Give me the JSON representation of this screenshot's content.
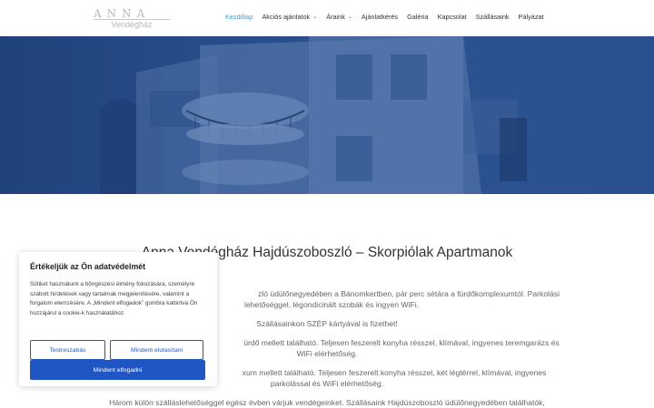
{
  "logo": {
    "top": "ANNA",
    "bottom": "Vendégház"
  },
  "nav": [
    {
      "label": "Kezdőlap",
      "active": true,
      "dropdown": false
    },
    {
      "label": "Akciós ajánlatok",
      "active": false,
      "dropdown": true
    },
    {
      "label": "Áraink",
      "active": false,
      "dropdown": true
    },
    {
      "label": "Ajánlatkérés",
      "active": false,
      "dropdown": false
    },
    {
      "label": "Galéria",
      "active": false,
      "dropdown": false
    },
    {
      "label": "Kapcsolat",
      "active": false,
      "dropdown": false
    },
    {
      "label": "Szállásaink",
      "active": false,
      "dropdown": false
    },
    {
      "label": "Pályázat",
      "active": false,
      "dropdown": false
    }
  ],
  "main": {
    "title": "Anna Vendégház Hajdúszoboszló – Skorpiólak Apartmanok",
    "paragraphs": [
      "zló üdülőnegyedében a Bánomkertben, pár perc sétára a fürdőkomplexumtól. Parkolási",
      "lehetőséggel, légondicinált szobák és ingyen WiFi.",
      "Szállásainkon SZÉP kártyával is fizethet!",
      "ürdő mellett található. Teljesen feszerelt konyha résszel, klímával, ingyenes teremgarázs és",
      "WiFi elérhetőség.",
      "xum mellett található. Teljesen feszerelt konyha résszel, két légtérrel, klímával, ingyenes",
      "parkolással és WiFi elérhetőség.",
      "Három külön szálláslehetőséggel egész évben várjuk vendégeinket. Szállásaink Hajdúszoboszló üdülőnegyedében találhatók,"
    ]
  },
  "cookie": {
    "title": "Értékeljük az Ön adatvédelmét",
    "text": "Sütiket használunk a böngészési élmény fokozására, személyre szabott hirdetések vagy tartalmak megjelenítésére, valamint a forgalom elemzésére. A „Mindent elfogadok” gombra kattintva Ön hozzájárul a cookie-k használatához.",
    "customize": "Testreszabás",
    "reject": "Mindent elutasítani",
    "accept": "Mindent elfogadni"
  },
  "colors": {
    "accent": "#2ea3f2",
    "cookie_button": "#1f56c4",
    "hero_overlay": "#2a4d86"
  }
}
